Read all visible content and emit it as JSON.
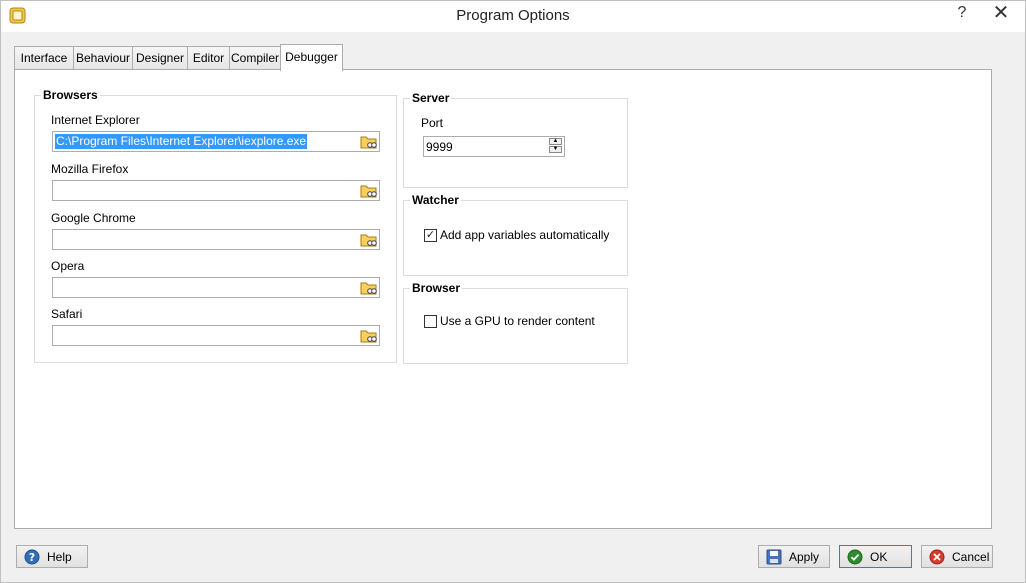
{
  "window": {
    "title": "Program Options",
    "help_glyph": "?",
    "close_glyph": "✕"
  },
  "tabs": [
    {
      "label": "Interface"
    },
    {
      "label": "Behaviour"
    },
    {
      "label": "Designer"
    },
    {
      "label": "Editor"
    },
    {
      "label": "Compiler"
    },
    {
      "label": "Debugger"
    }
  ],
  "active_tab": "Debugger",
  "browsers": {
    "title": "Browsers",
    "items": [
      {
        "label": "Internet Explorer",
        "value": "C:\\Program Files\\Internet Explorer\\iexplore.exe"
      },
      {
        "label": "Mozilla Firefox",
        "value": ""
      },
      {
        "label": "Google Chrome",
        "value": ""
      },
      {
        "label": "Opera",
        "value": ""
      },
      {
        "label": "Safari",
        "value": ""
      }
    ]
  },
  "server": {
    "title": "Server",
    "port_label": "Port",
    "port_value": "9999"
  },
  "watcher": {
    "title": "Watcher",
    "checkbox_label": "Add app variables automatically",
    "checked": true,
    "check_glyph": "✓"
  },
  "browser": {
    "title": "Browser",
    "checkbox_label": "Use a GPU to render content",
    "checked": false
  },
  "footer": {
    "help_label": "Help",
    "apply_label": "Apply",
    "ok_label": "OK",
    "cancel_label": "Cancel"
  },
  "colors": {
    "selection": "#3399ff",
    "help_icon": "#2f6fb5",
    "ok_icon": "#2e8b2e",
    "cancel_icon": "#d93a2e"
  }
}
